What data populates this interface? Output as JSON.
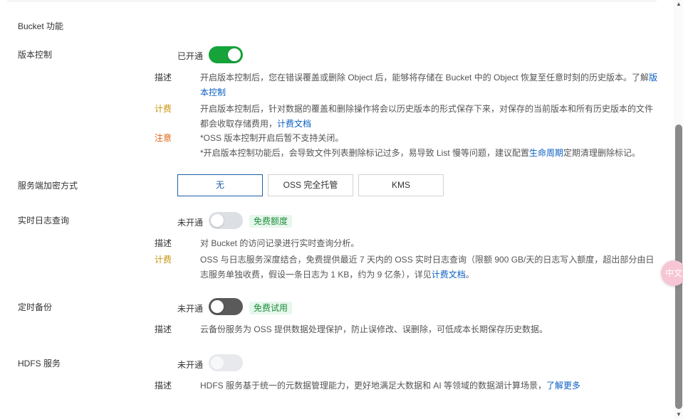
{
  "section_title": "Bucket 功能",
  "versioning": {
    "label": "版本控制",
    "status": "已开通",
    "desc_label": "描述",
    "desc_text": "开启版本控制后，您在错误覆盖或删除 Object 后，能够将存储在 Bucket 中的 Object 恢复至任意时刻的历史版本。了解",
    "desc_link": "版本控制",
    "fee_label": "计费",
    "fee_text": "开启版本控制后，针对数据的覆盖和删除操作将会以历史版本的形式保存下来，对保存的当前版本和所有历史版本的文件都会收取存储费用，",
    "fee_link": "计费文档",
    "note_label": "注意",
    "note_line1": "*OSS 版本控制开启后暂不支持关闭。",
    "note_line2_pre": "*开启版本控制功能后，会导致文件列表删除标记过多，易导致 List 慢等问题，建议配置",
    "note_line2_link": "生命周期",
    "note_line2_post": "定期清理删除标记。"
  },
  "encryption": {
    "label": "服务端加密方式",
    "options": [
      "无",
      "OSS 完全托管",
      "KMS"
    ],
    "selected": "无"
  },
  "realtime_log": {
    "label": "实时日志查询",
    "status": "未开通",
    "tag": "免费额度",
    "desc_label": "描述",
    "desc_text": "对 Bucket 的访问记录进行实时查询分析。",
    "fee_label": "计费",
    "fee_text": "OSS 与日志服务深度结合，免费提供最近 7 天内的 OSS 实时日志查询（限额 900 GB/天的日志写入额度，超出部分由日志服务单独收费，假设一条日志为 1 KB，约为 9 亿条），详见",
    "fee_link": "计费文档",
    "fee_end": "。"
  },
  "scheduled_backup": {
    "label": "定时备份",
    "status": "未开通",
    "tag": "免费试用",
    "desc_label": "描述",
    "desc_text": "云备份服务为 OSS 提供数据处理保护，防止误修改、误删除，可低成本长期保存历史数据。"
  },
  "hdfs": {
    "label": "HDFS 服务",
    "status": "未开通",
    "desc_label": "描述",
    "desc_text": "HDFS 服务基于统一的元数据管理能力，更好地满足大数据和 AI 等领域的数据湖计算场景，",
    "desc_link": "了解更多"
  },
  "float_button": "中文",
  "colors": {
    "toggle_on": "#15a33a",
    "link": "#0a5ec2",
    "fee": "#c8930a",
    "warn": "#e36414",
    "tag_bg": "#e7f7ec",
    "tag_text": "#1e8e3e",
    "segment_active": "#1f5ea8"
  }
}
